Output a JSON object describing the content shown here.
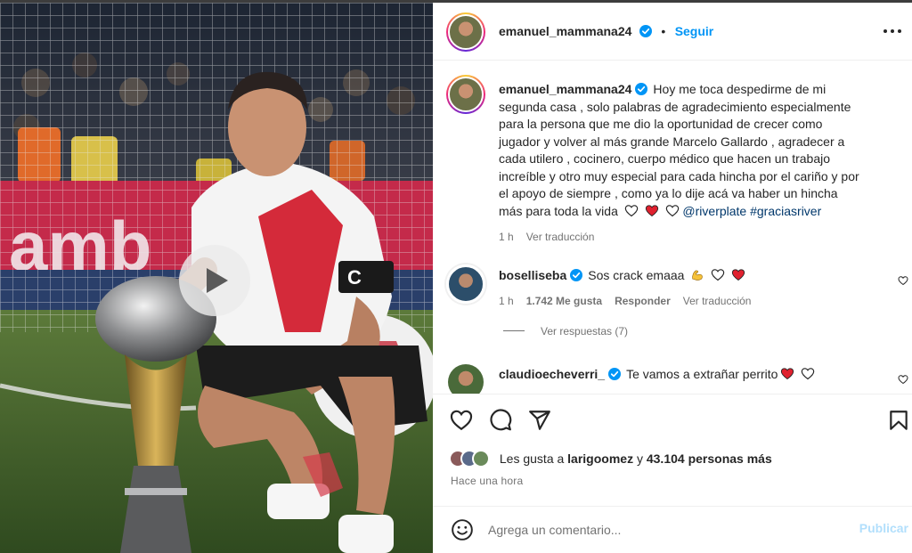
{
  "post": {
    "username": "emanuel_mammana24",
    "follow_label": "Seguir",
    "separator": "•"
  },
  "caption": {
    "username": "emanuel_mammana24",
    "text": "Hoy me toca despedirme de mi segunda casa , solo palabras de agradecimiento especialmente para la persona que me dio la oportunidad de crecer como jugador y volver al más grande Marcelo Gallardo , agradecer a cada utilero , cocinero, cuerpo médico que hacen un trabajo increíble y otro muy especial para cada hincha por el cariño y por el apoyo de siempre , como ya lo dije acá va haber un hincha más para toda la vida",
    "mention": "@riverplate",
    "hashtag": "#graciasriver",
    "time": "1 h",
    "translate": "Ver traducción"
  },
  "comments": [
    {
      "username": "boselliseba",
      "text": "Sos crack emaaa",
      "time": "1 h",
      "likes": "1.742 Me gusta",
      "reply": "Responder",
      "translate": "Ver traducción",
      "view_replies": "Ver respuestas (7)"
    },
    {
      "username": "claudioecheverri_",
      "text": "Te vamos a extrañar perrito"
    }
  ],
  "likes": {
    "prefix": "Les gusta a",
    "user": "larigoomez",
    "middle": "y",
    "count": "43.104 personas más"
  },
  "posted_when": "Hace una hora",
  "composer": {
    "placeholder": "Agrega un comentario...",
    "post_label": "Publicar"
  },
  "icons": {
    "verified_color": "#0095f6",
    "heart_red": "#ed4956",
    "accent": "#0095f6"
  }
}
